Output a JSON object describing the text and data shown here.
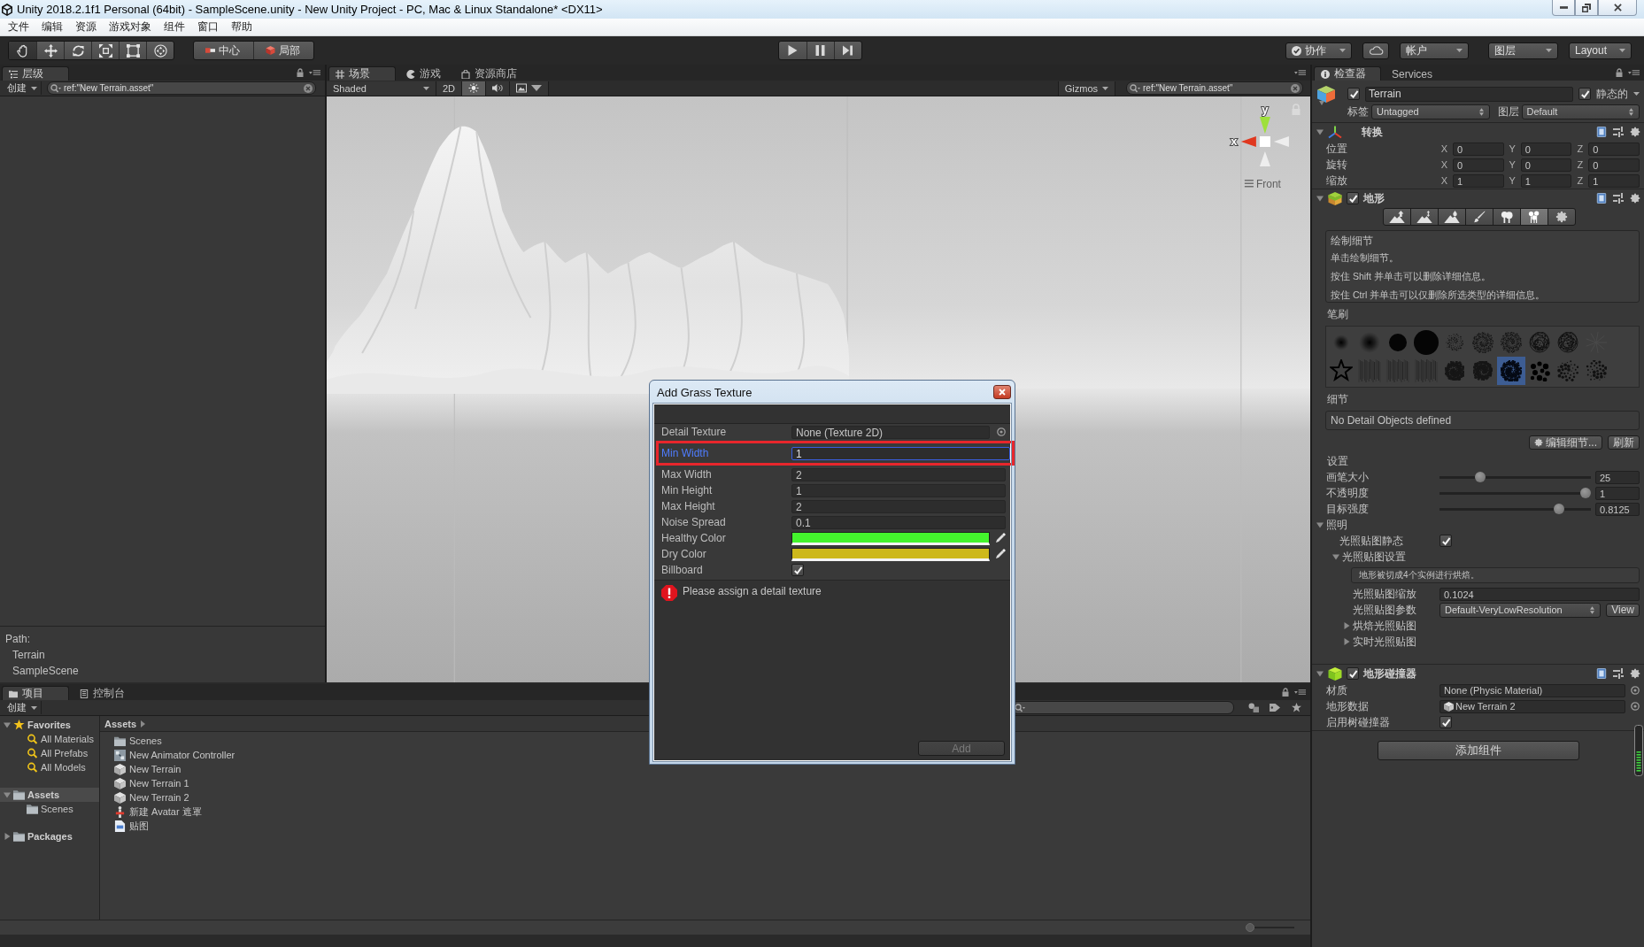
{
  "window": {
    "title": "Unity 2018.2.1f1 Personal (64bit) - SampleScene.unity - New Unity Project - PC, Mac & Linux Standalone* <DX11>"
  },
  "menu_bar": [
    "文件",
    "编辑",
    "资源",
    "游戏对象",
    "组件",
    "窗口",
    "帮助"
  ],
  "toolbar": {
    "tools": [
      {
        "kind": "hand",
        "selected": true
      },
      {
        "kind": "move",
        "selected": false
      },
      {
        "kind": "rotate",
        "selected": false
      },
      {
        "kind": "scale",
        "selected": false
      },
      {
        "kind": "rect",
        "selected": false
      },
      {
        "kind": "transform",
        "selected": false
      }
    ],
    "pivot": [
      {
        "kind": "pivot",
        "label": "中心"
      },
      {
        "kind": "space",
        "label": "局部"
      }
    ],
    "collab": "协作",
    "account": "帐户",
    "layers": "图层",
    "layout": "Layout"
  },
  "hierarchy": {
    "tabs": [
      {
        "label": "层级",
        "selected": true
      }
    ],
    "create": "创建",
    "search": "ref:\"New Terrain.asset\"",
    "path_label": "Path:",
    "path": [
      "Terrain",
      "SampleScene"
    ]
  },
  "scene": {
    "tabs": [
      {
        "kind": "scene",
        "label": "场景",
        "selected": true
      },
      {
        "kind": "game",
        "label": "游戏",
        "selected": false
      },
      {
        "kind": "store",
        "label": "资源商店",
        "selected": false
      }
    ],
    "shading": "Shaded",
    "mode_2d": {
      "label": "2D",
      "on": false
    },
    "lighting_on": true,
    "audio_on": false,
    "gizmos": "Gizmos",
    "search": "ref:\"New Terrain.asset\"",
    "gizmo_labels": [
      "y",
      "x"
    ],
    "view_label": "Front"
  },
  "inspector": {
    "tabs": [
      {
        "kind": "inspector",
        "label": "检查器",
        "selected": true
      },
      {
        "kind": "services",
        "label": "Services",
        "selected": false
      }
    ],
    "object": {
      "active": true,
      "name": "Terrain",
      "static_label": "静态的",
      "static": true,
      "tag_label": "标签",
      "tag": "Untagged",
      "layer_label": "图层",
      "layer": "Default"
    },
    "transform": {
      "title": "转换",
      "expanded": true,
      "rows": [
        {
          "label": "位置",
          "values": [
            {
              "axis": "X",
              "value": "0"
            },
            {
              "axis": "Y",
              "value": "0"
            },
            {
              "axis": "Z",
              "value": "0"
            }
          ]
        },
        {
          "label": "旋转",
          "values": [
            {
              "axis": "X",
              "value": "0"
            },
            {
              "axis": "Y",
              "value": "0"
            },
            {
              "axis": "Z",
              "value": "0"
            }
          ]
        },
        {
          "label": "缩放",
          "values": [
            {
              "axis": "X",
              "value": "1"
            },
            {
              "axis": "Y",
              "value": "1"
            },
            {
              "axis": "Z",
              "value": "1"
            }
          ]
        }
      ]
    },
    "terrain": {
      "title": "地形",
      "enabled": true,
      "expanded": true,
      "tools": [
        {
          "kind": "raise",
          "selected": false
        },
        {
          "kind": "paint_height",
          "selected": false
        },
        {
          "kind": "smooth",
          "selected": false
        },
        {
          "kind": "paint_texture",
          "selected": false
        },
        {
          "kind": "trees",
          "selected": false
        },
        {
          "kind": "details",
          "selected": true
        },
        {
          "kind": "settings",
          "selected": false
        }
      ],
      "help_title": "绘制细节",
      "help_lines": [
        "单击绘制细节。",
        "按住 Shift 并单击可以删除详细信息。",
        "按住 Ctrl 并单击可以仅删除所选类型的详细信息。"
      ],
      "brushes_label": "笔刷",
      "brushes": [
        {
          "kind": "soft_small",
          "selected": false
        },
        {
          "kind": "soft",
          "selected": false
        },
        {
          "kind": "round",
          "selected": false
        },
        {
          "kind": "round_large",
          "selected": false
        },
        {
          "kind": "speck",
          "selected": false
        },
        {
          "kind": "noise",
          "selected": false
        },
        {
          "kind": "noise",
          "selected": false
        },
        {
          "kind": "scribble",
          "selected": false
        },
        {
          "kind": "scribble",
          "selected": false
        },
        {
          "kind": "spark",
          "selected": false
        },
        {
          "kind": "star",
          "selected": false
        },
        {
          "kind": "grain",
          "selected": false
        },
        {
          "kind": "grain",
          "selected": false
        },
        {
          "kind": "grain",
          "selected": false
        },
        {
          "kind": "smudge",
          "selected": false
        },
        {
          "kind": "smudge",
          "selected": false
        },
        {
          "kind": "splat",
          "selected": true
        },
        {
          "kind": "dots",
          "selected": false
        },
        {
          "kind": "splatter",
          "selected": false
        },
        {
          "kind": "splatter",
          "selected": false
        }
      ],
      "details_label": "细节",
      "details_empty": "No Detail Objects defined",
      "edit_button": "编辑细节...",
      "refresh_button": "刷新",
      "settings_label": "设置",
      "sliders": [
        {
          "label": "画笔大小",
          "level": 0.25,
          "value": "25"
        },
        {
          "label": "不透明度",
          "level": 1,
          "value": "1"
        },
        {
          "label": "目标强度",
          "level": 0.8125,
          "value": "0.8125"
        }
      ],
      "lighting": {
        "title": "照明",
        "expanded": true,
        "static_label": "光照贴图静态",
        "static": true,
        "settings_title": "光照贴图设置",
        "settings_expanded": true,
        "note": "地形被切成4个实例进行烘焙。",
        "scale_label": "光照贴图缩放",
        "scale": "0.1024",
        "params_label": "光照贴图参数",
        "params": "Default-VeryLowResolution",
        "view_button": "View",
        "sections": [
          {
            "title": "烘焙光照贴图",
            "expanded": false
          },
          {
            "title": "实时光照贴图",
            "expanded": false
          }
        ]
      }
    },
    "collider": {
      "title": "地形碰撞器",
      "enabled": true,
      "expanded": true,
      "rows": [
        {
          "kind": "object",
          "label": "材质",
          "value": "None (Physic Material)"
        },
        {
          "kind": "asset",
          "label": "地形数据",
          "value": "New Terrain 2"
        },
        {
          "kind": "toggle",
          "label": "启用树碰撞器",
          "checked": true
        }
      ]
    },
    "add_component": "添加组件"
  },
  "project": {
    "tabs": [
      {
        "kind": "project",
        "label": "项目",
        "selected": true
      },
      {
        "kind": "console",
        "label": "控制台",
        "selected": false
      }
    ],
    "create": "创建",
    "tree": [
      {
        "kind": "favorites",
        "label": "Favorites",
        "expanded": true,
        "selected": false,
        "children": [
          {
            "kind": "search",
            "label": "All Materials",
            "selected": false
          },
          {
            "kind": "search",
            "label": "All Prefabs",
            "selected": false
          },
          {
            "kind": "search",
            "label": "All Models",
            "selected": false
          }
        ]
      },
      {
        "kind": "folder",
        "label": "Assets",
        "expanded": true,
        "selected": true,
        "children": [
          {
            "kind": "folder",
            "label": "Scenes",
            "selected": false
          }
        ]
      },
      {
        "kind": "folder",
        "label": "Packages",
        "expanded": false,
        "selected": false
      }
    ],
    "breadcrumb": "Assets",
    "assets": [
      {
        "kind": "folder",
        "label": "Scenes",
        "selected": false
      },
      {
        "kind": "animator",
        "label": "New Animator Controller",
        "selected": false
      },
      {
        "kind": "terrain",
        "label": "New Terrain",
        "selected": false
      },
      {
        "kind": "terrain",
        "label": "New Terrain 1",
        "selected": false
      },
      {
        "kind": "terrain",
        "label": "New Terrain 2",
        "selected": false
      },
      {
        "kind": "avatar_mask",
        "label": "新建 Avatar 遮罩",
        "selected": false
      },
      {
        "kind": "script",
        "label": "贴图",
        "selected": false
      }
    ],
    "icon_size_slider": {
      "level": 0
    }
  },
  "dialog": {
    "title": "Add Grass Texture",
    "fields": [
      {
        "kind": "object",
        "label": "Detail Texture",
        "value": "None (Texture 2D)",
        "focused": false,
        "highlighted": false
      },
      {
        "kind": "number",
        "label": "Min Width",
        "value": "1",
        "focused": true,
        "highlighted": true
      },
      {
        "kind": "number",
        "label": "Max Width",
        "value": "2",
        "focused": false,
        "highlighted": false
      },
      {
        "kind": "number",
        "label": "Min Height",
        "value": "1",
        "focused": false,
        "highlighted": false
      },
      {
        "kind": "number",
        "label": "Max Height",
        "value": "2",
        "focused": false,
        "highlighted": false
      },
      {
        "kind": "number",
        "label": "Noise Spread",
        "value": "0.1",
        "focused": false,
        "highlighted": false
      },
      {
        "kind": "color",
        "label": "Healthy Color",
        "color": "#44f52d",
        "focused": false,
        "highlighted": false
      },
      {
        "kind": "color",
        "label": "Dry Color",
        "color": "#cdb81c",
        "focused": false,
        "highlighted": false
      },
      {
        "kind": "toggle",
        "label": "Billboard",
        "checked": true,
        "focused": false,
        "highlighted": false
      }
    ],
    "error": "Please assign a detail texture",
    "add_button": {
      "label": "Add",
      "disabled": true
    }
  }
}
